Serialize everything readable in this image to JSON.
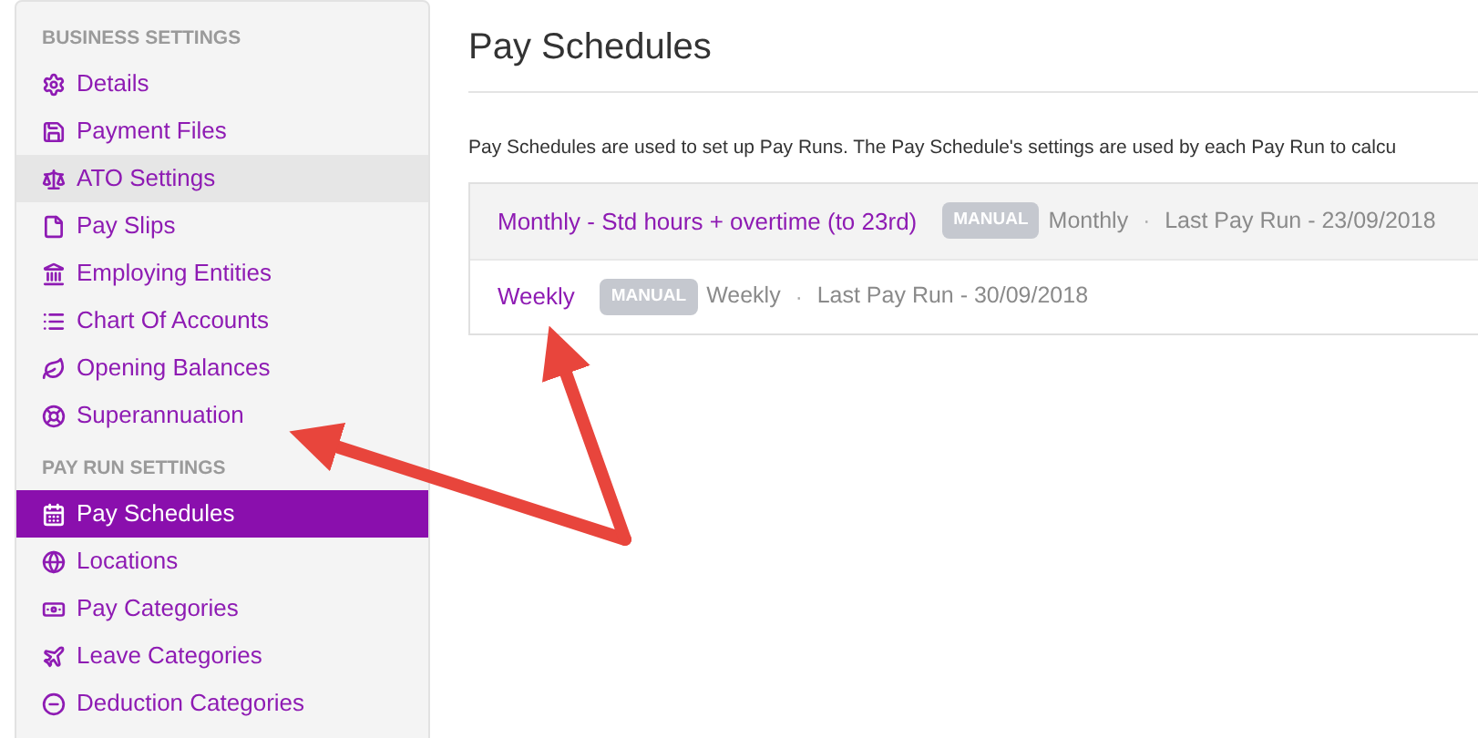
{
  "sidebar": {
    "sections": [
      {
        "heading": "BUSINESS SETTINGS",
        "items": [
          {
            "label": "Details",
            "selected": false,
            "hovered": false
          },
          {
            "label": "Payment Files",
            "selected": false,
            "hovered": false
          },
          {
            "label": "ATO Settings",
            "selected": false,
            "hovered": true
          },
          {
            "label": "Pay Slips",
            "selected": false,
            "hovered": false
          },
          {
            "label": "Employing Entities",
            "selected": false,
            "hovered": false
          },
          {
            "label": "Chart Of Accounts",
            "selected": false,
            "hovered": false
          },
          {
            "label": "Opening Balances",
            "selected": false,
            "hovered": false
          },
          {
            "label": "Superannuation",
            "selected": false,
            "hovered": false
          }
        ]
      },
      {
        "heading": "PAY RUN SETTINGS",
        "items": [
          {
            "label": "Pay Schedules",
            "selected": true
          },
          {
            "label": "Locations",
            "selected": false,
            "hovered": false
          },
          {
            "label": "Pay Categories",
            "selected": false,
            "hovered": false
          },
          {
            "label": "Leave Categories",
            "selected": false,
            "hovered": false
          },
          {
            "label": "Deduction Categories",
            "selected": false,
            "hovered": false
          }
        ]
      }
    ]
  },
  "page": {
    "title": "Pay Schedules",
    "description": "Pay Schedules are used to set up Pay Runs. The Pay Schedule's settings are used by each Pay Run to calcu"
  },
  "schedules": [
    {
      "name": "Monthly - Std hours + overtime (to 23rd)",
      "badge": "MANUAL",
      "frequency": "Monthly",
      "separator": "·",
      "last_run": "Last Pay Run - 23/09/2018",
      "hovered": true
    },
    {
      "name": "Weekly",
      "badge": "MANUAL",
      "frequency": "Weekly",
      "separator": "·",
      "last_run": "Last Pay Run - 30/09/2018",
      "hovered": false
    }
  ]
}
